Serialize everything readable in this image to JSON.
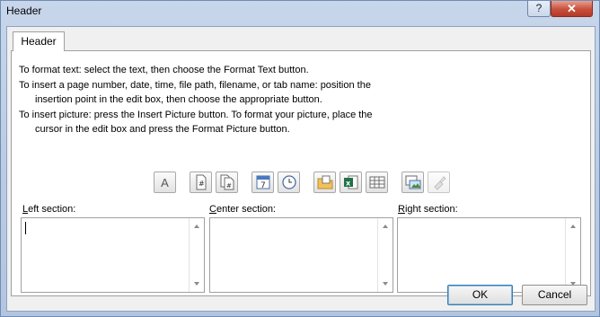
{
  "window": {
    "title": "Header",
    "help_label": "?",
    "close_label": "✕"
  },
  "tab": {
    "label": "Header"
  },
  "instructions": {
    "line1": "To format text:  select the text, then choose the Format Text button.",
    "line2": "To insert a page number, date, time, file path, filename, or tab name:  position the",
    "line3": "insertion point in the edit box, then choose the appropriate button.",
    "line4": "To insert picture: press the Insert Picture button.  To format your picture, place the",
    "line5": "cursor in the edit box and press the Format Picture button."
  },
  "toolbar": {
    "buttons": [
      {
        "name": "format-text",
        "icon": "A"
      },
      {
        "name": "insert-page-number",
        "icon": "#"
      },
      {
        "name": "insert-number-of-pages",
        "icon": "#"
      },
      {
        "name": "insert-date",
        "icon": "7"
      },
      {
        "name": "insert-time",
        "icon": "clock"
      },
      {
        "name": "insert-file-path",
        "icon": "folder"
      },
      {
        "name": "insert-file-name",
        "icon": "excel"
      },
      {
        "name": "insert-sheet-name",
        "icon": "grid"
      },
      {
        "name": "insert-picture",
        "icon": "picture"
      },
      {
        "name": "format-picture",
        "icon": "paint",
        "disabled": true
      }
    ]
  },
  "sections": {
    "left": {
      "accel": "L",
      "rest": "eft section:"
    },
    "center": {
      "accel": "C",
      "rest": "enter section:"
    },
    "right": {
      "accel": "R",
      "rest": "ight section:"
    }
  },
  "buttons": {
    "ok": "OK",
    "cancel": "Cancel"
  }
}
